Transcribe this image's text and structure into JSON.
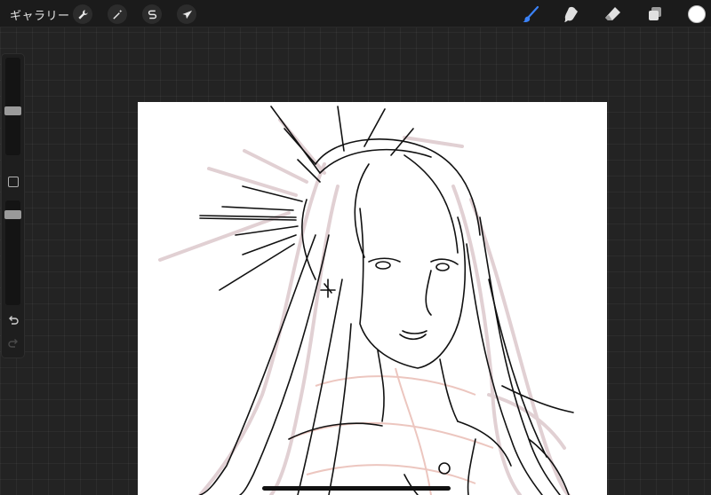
{
  "toolbar": {
    "gallery_label": "ギャラリー",
    "left_tools": [
      {
        "name": "actions",
        "icon": "wrench-icon"
      },
      {
        "name": "adjustments",
        "icon": "magic-wand-icon"
      },
      {
        "name": "selection",
        "icon": "selection-s-icon"
      },
      {
        "name": "transform",
        "icon": "arrow-cursor-icon"
      }
    ],
    "right_tools": [
      {
        "name": "brush",
        "icon": "brush-icon",
        "active": true
      },
      {
        "name": "smudge",
        "icon": "smudge-icon"
      },
      {
        "name": "eraser",
        "icon": "eraser-icon"
      },
      {
        "name": "layers",
        "icon": "layers-icon"
      }
    ],
    "current_color": "#ffffff",
    "active_color": "#3b82f6"
  },
  "sidebar": {
    "brush_size_level": 0.45,
    "opacity_level": 0.9,
    "undo_icon": "undo-icon",
    "redo_icon": "redo-icon"
  },
  "canvas": {
    "background": "#ffffff",
    "content": "line-art-illustration"
  }
}
